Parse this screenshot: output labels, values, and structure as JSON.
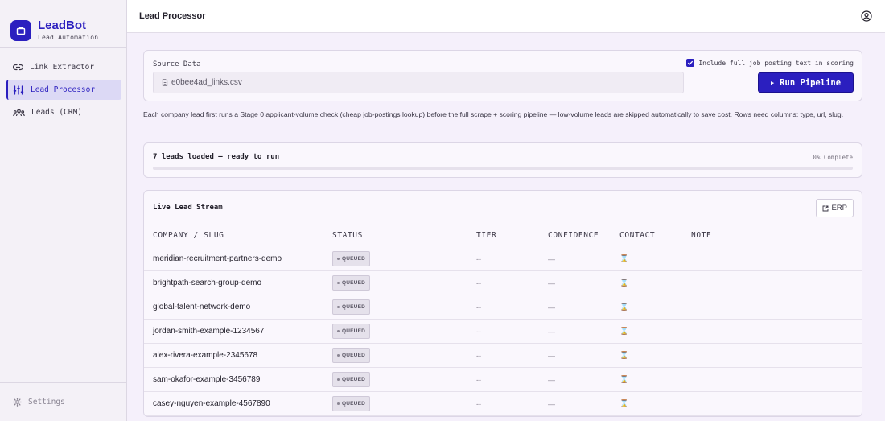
{
  "brand": {
    "name": "LeadBot",
    "subtitle": "Lead Automation"
  },
  "sidebar": {
    "items": [
      {
        "label": "Link Extractor",
        "icon": "link-icon",
        "active": false
      },
      {
        "label": "Lead Processor",
        "icon": "sliders-icon",
        "active": true
      },
      {
        "label": "Leads (CRM)",
        "icon": "users-icon",
        "active": false
      }
    ],
    "settings_label": "Settings"
  },
  "header": {
    "title": "Lead Processor"
  },
  "source": {
    "label": "Source Data",
    "file_name": "e0bee4ad_links.csv",
    "include_label": "Include full job posting text in scoring",
    "include_checked": true,
    "run_label": "Run Pipeline"
  },
  "description": "Each company lead first runs a Stage 0 applicant-volume check (cheap job-postings lookup) before the full scrape + scoring pipeline — low-volume leads are skipped automatically to save cost. Rows need columns: type, url, slug.",
  "progress": {
    "status": "7 leads loaded — ready to run",
    "percent_label": "0% Complete",
    "percent": 0
  },
  "stream": {
    "title": "Live Lead Stream",
    "erp_label": "ERP",
    "columns": [
      "COMPANY / SLUG",
      "STATUS",
      "TIER",
      "CONFIDENCE",
      "CONTACT",
      "NOTE"
    ],
    "rows": [
      {
        "slug": "meridian-recruitment-partners-demo",
        "status": "QUEUED",
        "tier": "--",
        "confidence": "—",
        "contact": "⌛",
        "note": ""
      },
      {
        "slug": "brightpath-search-group-demo",
        "status": "QUEUED",
        "tier": "--",
        "confidence": "—",
        "contact": "⌛",
        "note": ""
      },
      {
        "slug": "global-talent-network-demo",
        "status": "QUEUED",
        "tier": "--",
        "confidence": "—",
        "contact": "⌛",
        "note": ""
      },
      {
        "slug": "jordan-smith-example-1234567",
        "status": "QUEUED",
        "tier": "--",
        "confidence": "—",
        "contact": "⌛",
        "note": ""
      },
      {
        "slug": "alex-rivera-example-2345678",
        "status": "QUEUED",
        "tier": "--",
        "confidence": "—",
        "contact": "⌛",
        "note": ""
      },
      {
        "slug": "sam-okafor-example-3456789",
        "status": "QUEUED",
        "tier": "--",
        "confidence": "—",
        "contact": "⌛",
        "note": ""
      },
      {
        "slug": "casey-nguyen-example-4567890",
        "status": "QUEUED",
        "tier": "--",
        "confidence": "—",
        "contact": "⌛",
        "note": ""
      }
    ]
  },
  "colors": {
    "accent": "#2b1fbf",
    "background": "#f5f0fb",
    "sidebar": "#f4f1f7",
    "badge": "#e5e1eb"
  }
}
